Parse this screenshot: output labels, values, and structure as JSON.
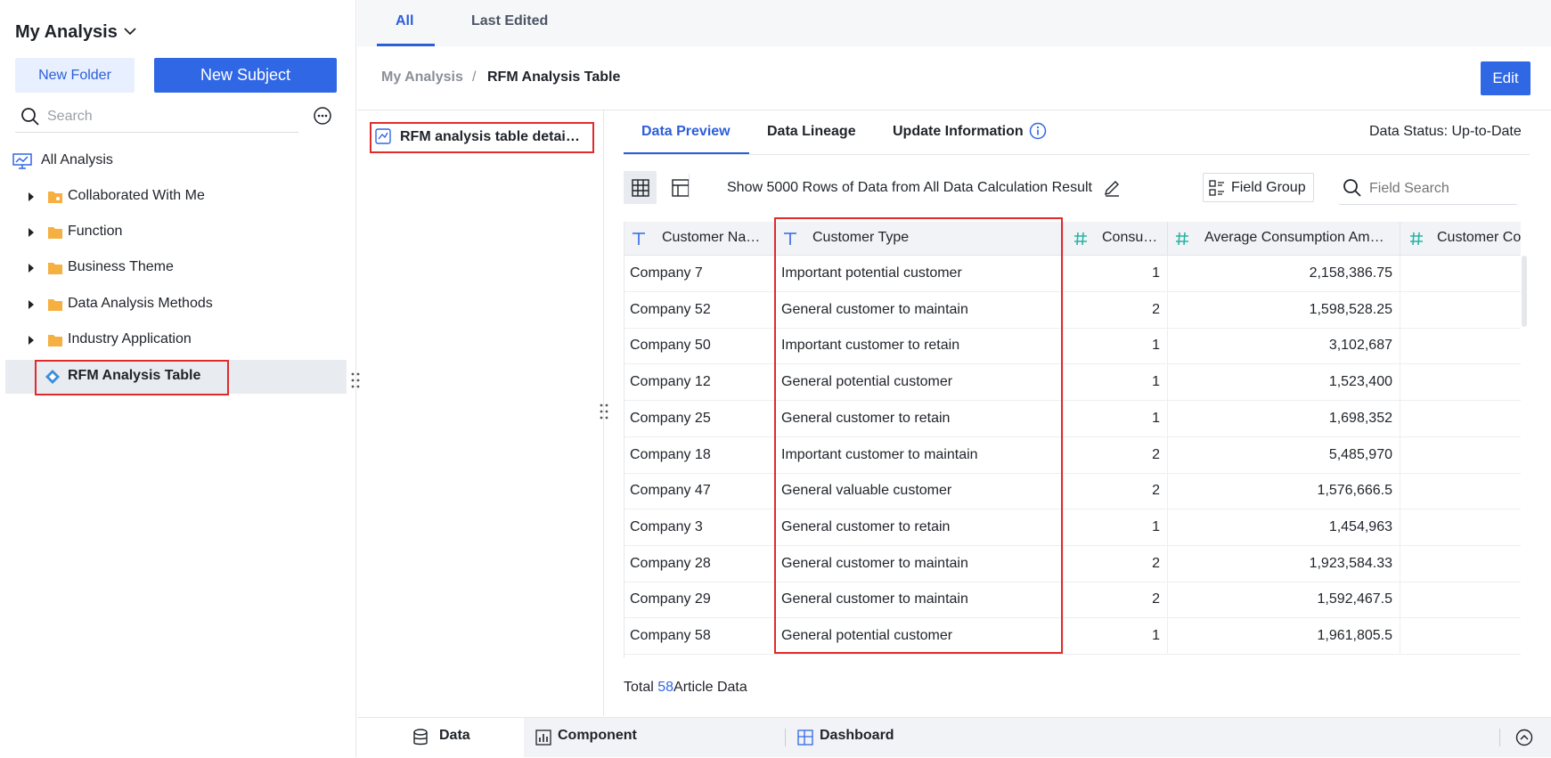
{
  "sidebar": {
    "title": "My Analysis",
    "new_folder": "New Folder",
    "new_subject": "New Subject",
    "search_placeholder": "Search",
    "all_analysis": "All Analysis",
    "items": [
      {
        "label": "Collaborated With Me"
      },
      {
        "label": "Function"
      },
      {
        "label": "Business Theme"
      },
      {
        "label": "Data Analysis Methods"
      },
      {
        "label": "Industry Application"
      }
    ],
    "active_item": "RFM Analysis Table"
  },
  "top_tabs": {
    "all": "All",
    "last_edited": "Last Edited"
  },
  "breadcrumb": {
    "parent": "My Analysis",
    "separator": "/",
    "current": "RFM Analysis Table"
  },
  "edit_button": "Edit",
  "mid_panel": {
    "item": "RFM analysis table detai…"
  },
  "sub_tabs": {
    "data_preview": "Data Preview",
    "data_lineage": "Data Lineage",
    "update_info": "Update Information"
  },
  "data_status": "Data Status: Up-to-Date",
  "toolbar": {
    "show_rows": "Show 5000 Rows of Data from All Data Calculation Result",
    "field_group": "Field Group",
    "field_search_placeholder": "Field Search"
  },
  "table": {
    "headers": [
      "Customer Na…",
      "Customer Type",
      "Consu…",
      "Average Consumption Am…",
      "Customer Co"
    ],
    "rows": [
      [
        "Company 7",
        "Important potential customer",
        "1",
        "2,158,386.75"
      ],
      [
        "Company 52",
        "General customer to maintain",
        "2",
        "1,598,528.25"
      ],
      [
        "Company 50",
        "Important customer to retain",
        "1",
        "3,102,687"
      ],
      [
        "Company 12",
        "General potential customer",
        "1",
        "1,523,400"
      ],
      [
        "Company 25",
        "General customer to retain",
        "1",
        "1,698,352"
      ],
      [
        "Company 18",
        "Important customer to maintain",
        "2",
        "5,485,970"
      ],
      [
        "Company 47",
        "General valuable customer",
        "2",
        "1,576,666.5"
      ],
      [
        "Company 3",
        "General customer to retain",
        "1",
        "1,454,963"
      ],
      [
        "Company 28",
        "General customer to maintain",
        "2",
        "1,923,584.33"
      ],
      [
        "Company 29",
        "General customer to maintain",
        "2",
        "1,592,467.5"
      ],
      [
        "Company 58",
        "General potential customer",
        "1",
        "1,961,805.5"
      ]
    ]
  },
  "footer": {
    "total_prefix": "Total",
    "total_count": "58",
    "total_suffix": "Article Data"
  },
  "bottom_bar": {
    "data": "Data",
    "component": "Component",
    "dashboard": "Dashboard"
  }
}
